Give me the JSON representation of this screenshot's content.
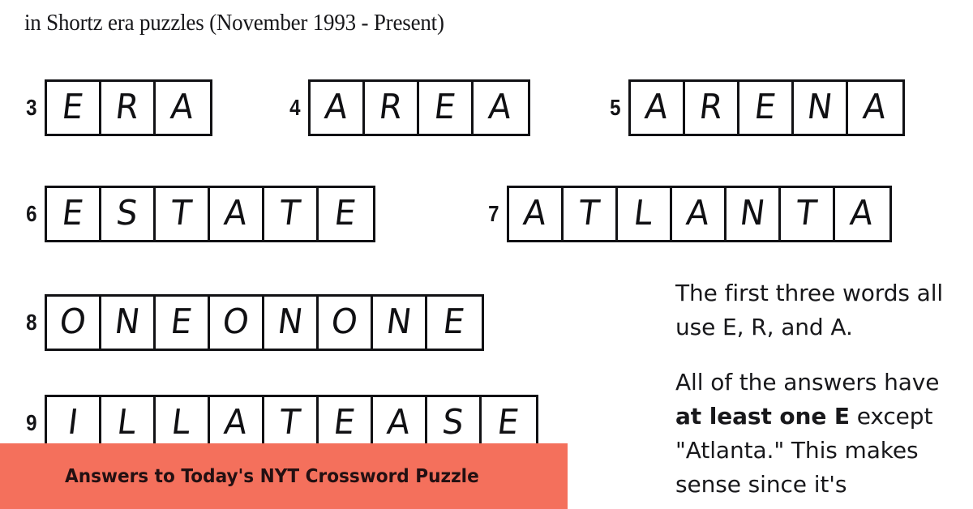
{
  "header": {
    "text": "in Shortz era puzzles (November 1993 - Present)"
  },
  "puzzle": {
    "entries": [
      {
        "number": "3",
        "answer": "ERA",
        "letters": [
          "E",
          "R",
          "A"
        ]
      },
      {
        "number": "4",
        "answer": "AREA",
        "letters": [
          "A",
          "R",
          "E",
          "A"
        ]
      },
      {
        "number": "5",
        "answer": "ARENA",
        "letters": [
          "A",
          "R",
          "E",
          "N",
          "A"
        ]
      },
      {
        "number": "6",
        "answer": "ESTATE",
        "letters": [
          "E",
          "S",
          "T",
          "A",
          "T",
          "E"
        ]
      },
      {
        "number": "7",
        "answer": "ATLANTA",
        "letters": [
          "A",
          "T",
          "L",
          "A",
          "N",
          "T",
          "A"
        ]
      },
      {
        "number": "8",
        "answer": "ONEONONE",
        "letters": [
          "O",
          "N",
          "E",
          "O",
          "N",
          "O",
          "N",
          "E"
        ]
      },
      {
        "number": "9",
        "answer": "ILLATEASE",
        "letters": [
          "I",
          "L",
          "L",
          "A",
          "T",
          "E",
          "A",
          "S",
          "E"
        ]
      }
    ]
  },
  "notes": {
    "paragraph_1": "The first three words all use E, R, and A.",
    "paragraph_2_part_1": "All of the answers have ",
    "paragraph_2_emphasis": "at least one E",
    "paragraph_2_part_2": " except \"Atlanta.\" This makes sense since it's"
  },
  "banner": {
    "text": "Answers to Today's NYT Crossword Puzzle",
    "background_color": "#f4705c",
    "text_color": "#231012"
  }
}
